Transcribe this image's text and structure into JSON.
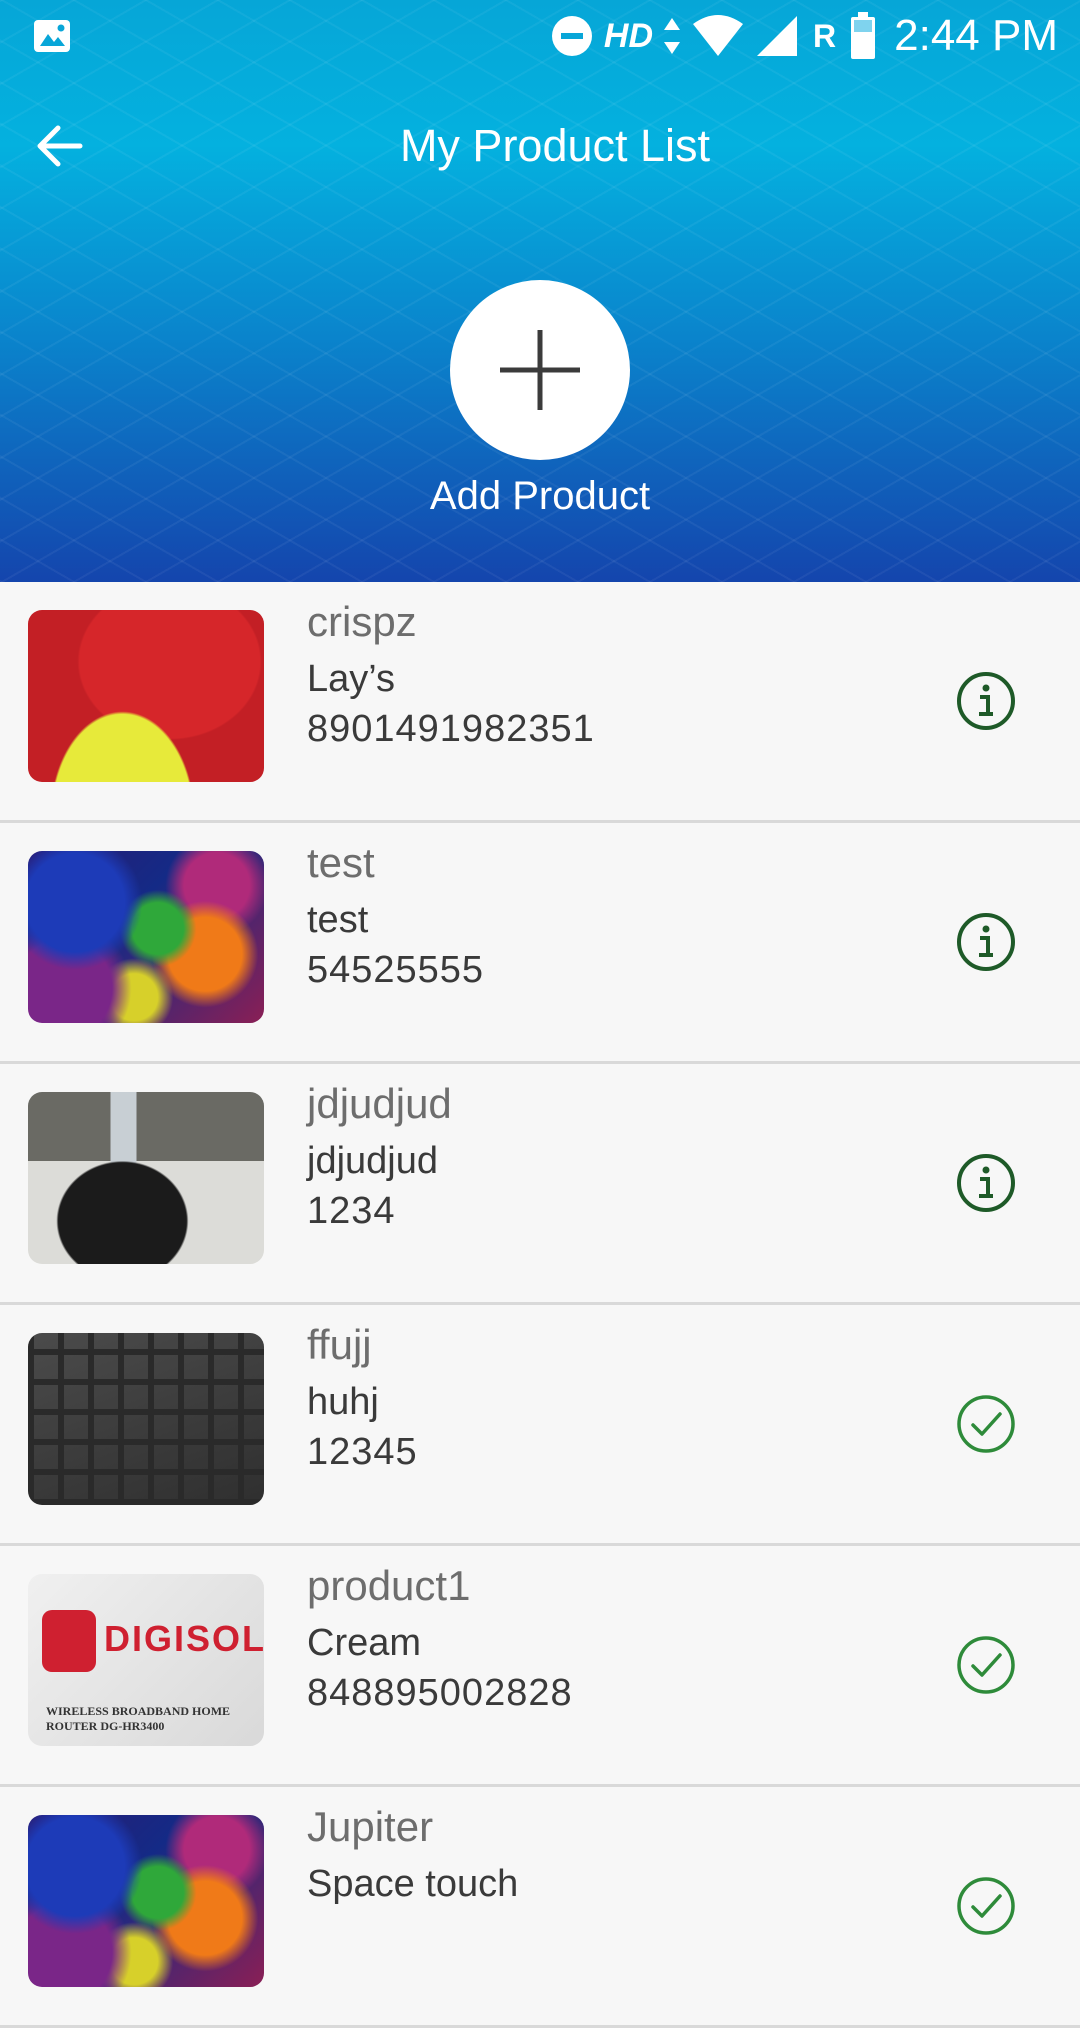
{
  "status_bar": {
    "network_label": "HD",
    "roaming_label": "R",
    "time": "2:44 PM"
  },
  "app_bar": {
    "title": "My Product List",
    "back_icon": "arrow-left-icon"
  },
  "add_product": {
    "label": "Add Product",
    "icon": "plus-icon"
  },
  "colors": {
    "header_top": "#04b1df",
    "header_bottom": "#1445ad",
    "status_green": "#1e5a28",
    "check_green": "#2e8b3a"
  },
  "products": [
    {
      "name": "crispz",
      "brand": "Lay’s",
      "code": "8901491982351",
      "status": "info",
      "thumb": "lays"
    },
    {
      "name": "test",
      "brand": "test",
      "code": "54525555",
      "status": "info",
      "thumb": "art"
    },
    {
      "name": "jdjudjud",
      "brand": "jdjudjud",
      "code": "1234",
      "status": "info",
      "thumb": "desk"
    },
    {
      "name": "ffujj",
      "brand": "huhj",
      "code": "12345",
      "status": "approved",
      "thumb": "keys"
    },
    {
      "name": "product1",
      "brand": "Cream",
      "code": "848895002828",
      "status": "approved",
      "thumb": "digisol",
      "thumb_text": "DIGISOL",
      "thumb_subtext": "WIRELESS BROADBAND HOME ROUTER DG-HR3400"
    },
    {
      "name": "Jupiter",
      "brand": "Space touch",
      "code": "",
      "status": "approved",
      "thumb": "art"
    }
  ]
}
